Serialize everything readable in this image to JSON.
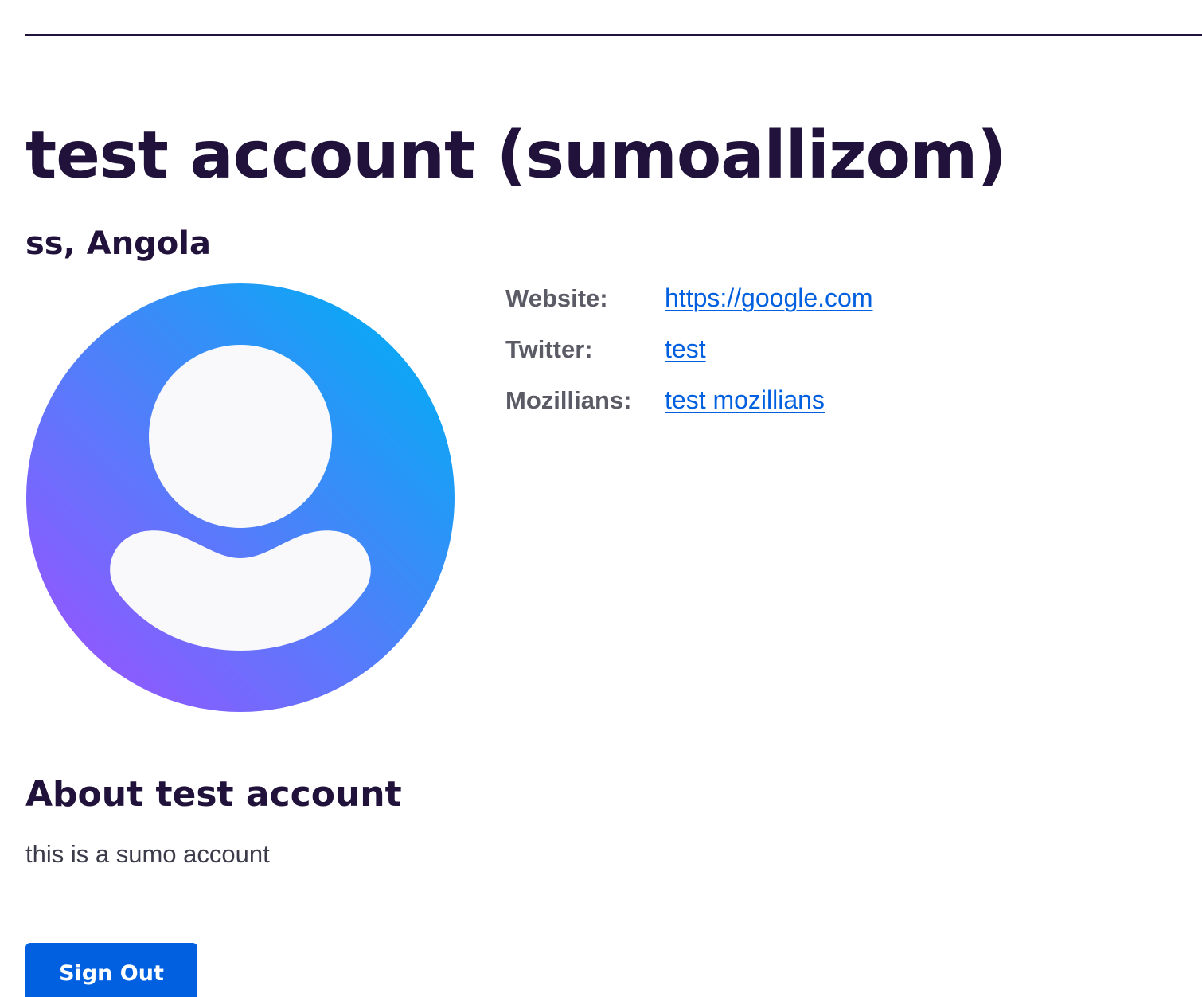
{
  "profile": {
    "name": "test account (sumoallizom)",
    "location": "ss, Angola",
    "avatar_icon": "user-avatar-icon",
    "avatar_gradient": [
      "#9059ff",
      "#0aa8f5"
    ]
  },
  "details": [
    {
      "label": "Website:",
      "value": "https://google.com"
    },
    {
      "label": "Twitter:",
      "value": "test"
    },
    {
      "label": "Mozillians:",
      "value": "test mozillians"
    }
  ],
  "about": {
    "heading": "About test account",
    "text": "this is a sumo account"
  },
  "actions": {
    "sign_out_label": "Sign Out"
  },
  "colors": {
    "heading": "#20123a",
    "link": "#0060df",
    "button": "#0060df",
    "label": "#5b5b66"
  }
}
